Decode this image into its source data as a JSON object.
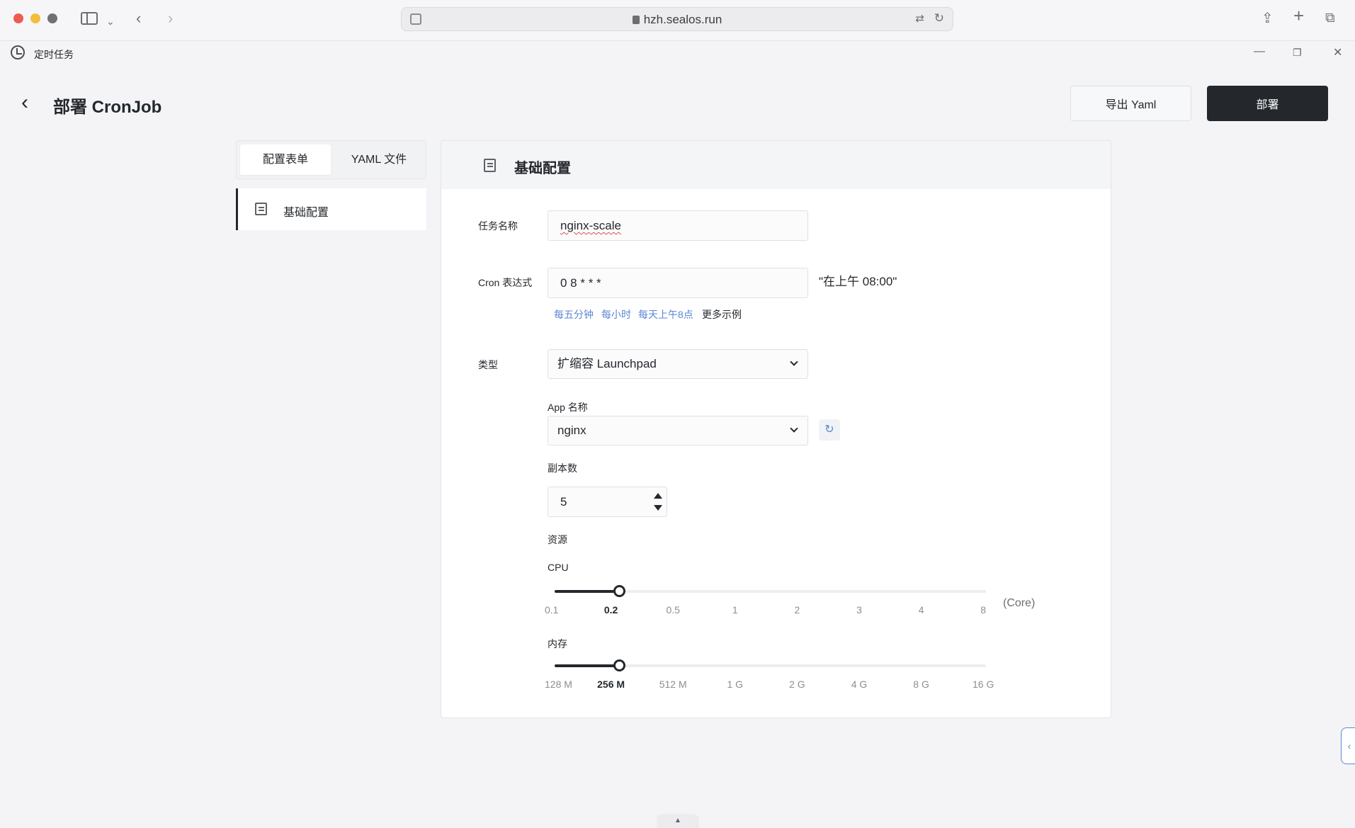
{
  "browser": {
    "url": "hzh.sealos.run"
  },
  "app": {
    "title": "定时任务"
  },
  "header": {
    "title": "部署 CronJob",
    "export_label": "导出 Yaml",
    "deploy_label": "部署"
  },
  "nav": {
    "tabs": [
      {
        "label": "配置表单",
        "active": true
      },
      {
        "label": "YAML 文件",
        "active": false
      }
    ],
    "items": [
      {
        "label": "基础配置",
        "active": true
      }
    ]
  },
  "form": {
    "section_title": "基础配置",
    "task_name": {
      "label": "任务名称",
      "value": "nginx-scale"
    },
    "cron": {
      "label": "Cron 表达式",
      "value": "0 8 * * *",
      "description": "\"在上午 08:00\"",
      "quick_links": [
        "每五分钟",
        "每小时",
        "每天上午8点"
      ],
      "more_label": "更多示例"
    },
    "type": {
      "label": "类型",
      "value": "扩缩容 Launchpad"
    },
    "app_name": {
      "label": "App 名称",
      "value": "nginx"
    },
    "replicas": {
      "label": "副本数",
      "value": "5"
    },
    "resources_label": "资源",
    "cpu": {
      "label": "CPU",
      "unit": "(Core)",
      "ticks": [
        "0.1",
        "0.2",
        "0.5",
        "1",
        "2",
        "3",
        "4",
        "8"
      ],
      "selected_index": 1
    },
    "memory": {
      "label": "内存",
      "ticks": [
        "128 M",
        "256 M",
        "512 M",
        "1 G",
        "2 G",
        "4 G",
        "8 G",
        "16 G"
      ],
      "selected_index": 1
    }
  },
  "colors": {
    "accent": "#24282c",
    "link": "#5b87d6",
    "background": "#f4f4f7"
  }
}
